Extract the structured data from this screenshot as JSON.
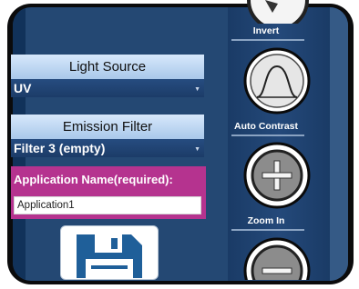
{
  "light_source": {
    "label": "Light Source",
    "value": "UV"
  },
  "emission_filter": {
    "label": "Emission Filter",
    "value": "Filter 3 (empty)"
  },
  "application_name": {
    "label": "Application Name(required):",
    "value": "Application1"
  },
  "toolbar": {
    "invert": "Invert",
    "auto_contrast": "Auto Contrast",
    "zoom_in": "Zoom In"
  },
  "colors": {
    "panel_bg": "#244873",
    "app_name_bg": "#b5338f",
    "dropdown_label_bg": "#bcd7f3"
  }
}
